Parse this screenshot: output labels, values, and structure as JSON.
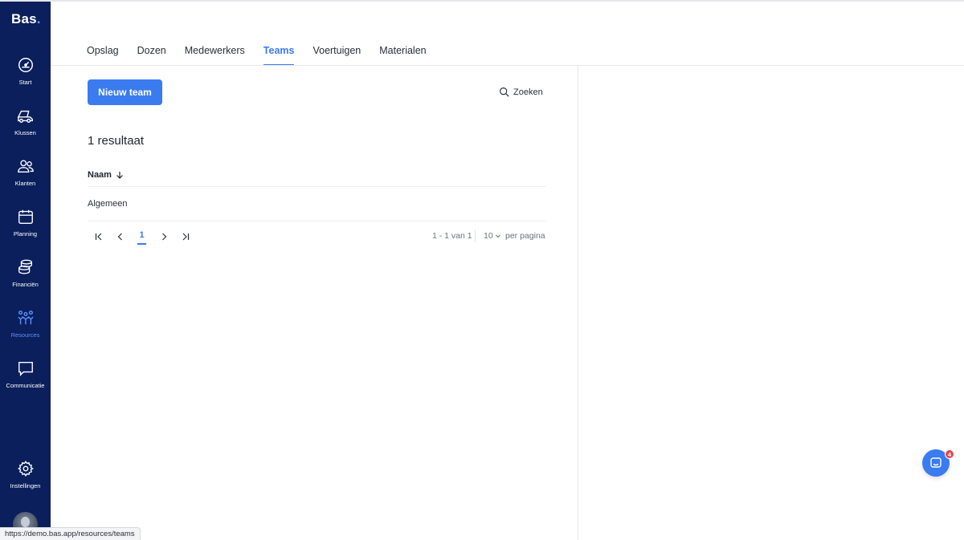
{
  "brand": {
    "name": "Bas",
    "dot": "."
  },
  "sidebar": {
    "items": [
      {
        "label": "Start",
        "icon": "gauge-icon"
      },
      {
        "label": "Klussen",
        "icon": "dump-truck-icon"
      },
      {
        "label": "Klanten",
        "icon": "users-icon"
      },
      {
        "label": "Planning",
        "icon": "calendar-icon"
      },
      {
        "label": "Financiën",
        "icon": "coins-icon"
      },
      {
        "label": "Resources",
        "icon": "team-resources-icon",
        "active": true
      },
      {
        "label": "Communicatie",
        "icon": "chat-bubble-icon"
      },
      {
        "label": "Instellingen",
        "icon": "gear-icon"
      }
    ]
  },
  "tabs": [
    {
      "label": "Opslag"
    },
    {
      "label": "Dozen"
    },
    {
      "label": "Medewerkers"
    },
    {
      "label": "Teams",
      "active": true
    },
    {
      "label": "Voertuigen"
    },
    {
      "label": "Materialen"
    }
  ],
  "toolbar": {
    "new_label": "Nieuw team",
    "search_label": "Zoeken"
  },
  "results_label": "1 resultaat",
  "table": {
    "columns": [
      {
        "label": "Naam",
        "sort": "descending"
      }
    ],
    "rows": [
      {
        "name": "Algemeen"
      }
    ]
  },
  "pagination": {
    "current_page": "1",
    "range": "1 - 1 van 1",
    "per_page": "10",
    "per_page_label": "per pagina"
  },
  "chat": {
    "badge": "4"
  },
  "status_url": "https://demo.bas.app/resources/teams",
  "colors": {
    "sidebar": "#0a1f5c",
    "accent": "#3b7bf0",
    "badge": "#e5484d"
  }
}
